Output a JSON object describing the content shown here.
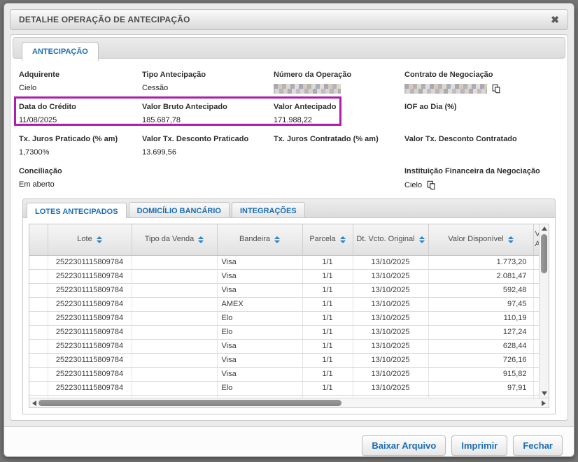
{
  "colors": {
    "accent_blue": "#1a6db6",
    "highlight_purple": "#ae1cac"
  },
  "dialog": {
    "title": "DETALHE OPERAÇÃO DE ANTECIPAÇÃO",
    "close_icon": "✖"
  },
  "tabs": {
    "main": "ANTECIPAÇÃO",
    "inner": [
      "LOTES ANTECIPADOS",
      "DOMICÍLIO BANCÁRIO",
      "INTEGRAÇÕES"
    ],
    "inner_active": "LOTES ANTECIPADOS"
  },
  "fields": [
    {
      "label": "Adquirente",
      "value": "Cielo"
    },
    {
      "label": "Tipo Antecipação",
      "value": "Cessão"
    },
    {
      "label": "Número da Operação",
      "value": ""
    },
    {
      "label": "Contrato de Negociação",
      "value": ""
    },
    {
      "label": "Data do Crédito",
      "value": "11/08/2025"
    },
    {
      "label": "Valor Bruto Antecipado",
      "value": "185.687,78"
    },
    {
      "label": "Valor Antecipado",
      "value": "171.988,22"
    },
    {
      "label": "IOF ao Dia (%)",
      "value": ""
    },
    {
      "label": "Tx. Juros Praticado (% am)",
      "value": "1,7300%"
    },
    {
      "label": "Valor Tx. Desconto Praticado",
      "value": "13.699,56"
    },
    {
      "label": "Tx. Juros Contratado (% am)",
      "value": ""
    },
    {
      "label": "Valor Tx. Desconto Contratado",
      "value": ""
    },
    {
      "label": "Conciliação",
      "value": "Em aberto"
    },
    {
      "label": "Instituição Financeira da Negociação",
      "value": "Cielo"
    }
  ],
  "table": {
    "headers": [
      "",
      "Lote",
      "Tipo da Venda",
      "Bandeira",
      "Parcela",
      "Dt. Vcto. Original",
      "Valor Disponível",
      "Valor Antecipado"
    ],
    "rows": [
      {
        "lote": "2522301115809784",
        "tipo_venda": "",
        "bandeira": "Visa",
        "parcela": "1/1",
        "dt_vcto": "13/10/2025",
        "valor_disponivel": "1.773,20"
      },
      {
        "lote": "2522301115809784",
        "tipo_venda": "",
        "bandeira": "Visa",
        "parcela": "1/1",
        "dt_vcto": "13/10/2025",
        "valor_disponivel": "2.081,47"
      },
      {
        "lote": "2522301115809784",
        "tipo_venda": "",
        "bandeira": "Visa",
        "parcela": "1/1",
        "dt_vcto": "13/10/2025",
        "valor_disponivel": "592,48"
      },
      {
        "lote": "2522301115809784",
        "tipo_venda": "",
        "bandeira": "AMEX",
        "parcela": "1/1",
        "dt_vcto": "13/10/2025",
        "valor_disponivel": "97,45"
      },
      {
        "lote": "2522301115809784",
        "tipo_venda": "",
        "bandeira": "Elo",
        "parcela": "1/1",
        "dt_vcto": "13/10/2025",
        "valor_disponivel": "110,19"
      },
      {
        "lote": "2522301115809784",
        "tipo_venda": "",
        "bandeira": "Elo",
        "parcela": "1/1",
        "dt_vcto": "13/10/2025",
        "valor_disponivel": "127,24"
      },
      {
        "lote": "2522301115809784",
        "tipo_venda": "",
        "bandeira": "Visa",
        "parcela": "1/1",
        "dt_vcto": "13/10/2025",
        "valor_disponivel": "628,44"
      },
      {
        "lote": "2522301115809784",
        "tipo_venda": "",
        "bandeira": "Visa",
        "parcela": "1/1",
        "dt_vcto": "13/10/2025",
        "valor_disponivel": "726,16"
      },
      {
        "lote": "2522301115809784",
        "tipo_venda": "",
        "bandeira": "Visa",
        "parcela": "1/1",
        "dt_vcto": "13/10/2025",
        "valor_disponivel": "915,82"
      },
      {
        "lote": "2522301115809784",
        "tipo_venda": "",
        "bandeira": "Elo",
        "parcela": "1/1",
        "dt_vcto": "13/10/2025",
        "valor_disponivel": "97,91"
      }
    ]
  },
  "buttons": {
    "download": "Baixar Arquivo",
    "print": "Imprimir",
    "close": "Fechar"
  }
}
